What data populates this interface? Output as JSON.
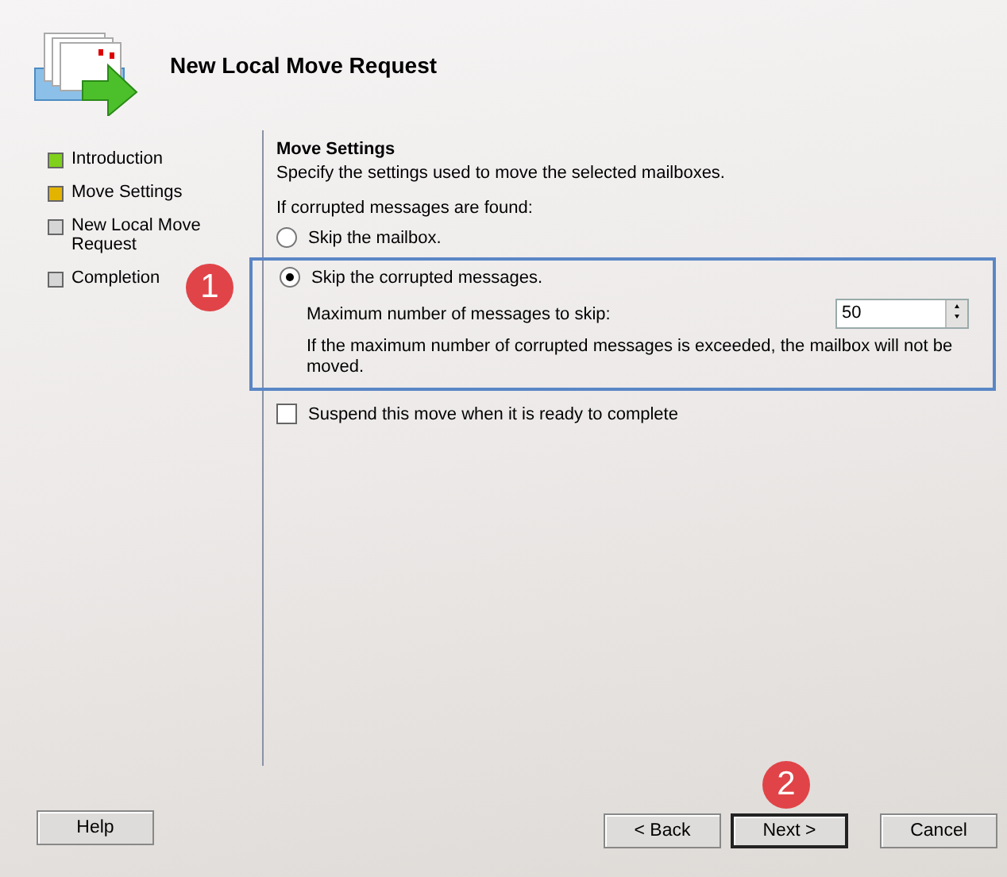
{
  "header": {
    "title": "New Local Move Request"
  },
  "steps": [
    {
      "label": "Introduction",
      "color": "#7fd11b"
    },
    {
      "label": "Move Settings",
      "color": "#e2b400"
    },
    {
      "label": "New Local Move Request",
      "color": "#d6d6d6"
    },
    {
      "label": "Completion",
      "color": "#d6d6d6"
    }
  ],
  "page": {
    "heading": "Move Settings",
    "description": "Specify the settings used to move the selected mailboxes.",
    "prompt": "If corrupted messages are found:",
    "options": [
      {
        "label": "Skip the mailbox.",
        "selected": false
      },
      {
        "label": "Skip the corrupted messages.",
        "selected": true
      }
    ],
    "max_skip": {
      "label": "Maximum number of messages to skip:",
      "value": "50",
      "note": "If the maximum number of corrupted messages is exceeded, the mailbox will not be moved."
    },
    "suspend": {
      "label": "Suspend this move when it is ready to complete",
      "checked": false
    }
  },
  "callouts": [
    "1",
    "2"
  ],
  "buttons": [
    {
      "label": "Help",
      "default": false
    },
    {
      "label": "< Back",
      "default": false
    },
    {
      "label": "Next >",
      "default": true
    },
    {
      "label": "Cancel",
      "default": false
    }
  ]
}
